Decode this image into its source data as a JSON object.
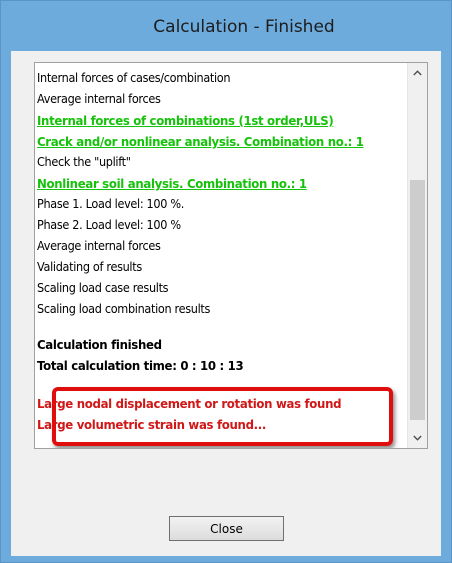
{
  "window": {
    "title": "Calculation - Finished"
  },
  "log": {
    "lines": [
      "Internal forces of cases/combination",
      "Average internal forces",
      "Internal forces of combinations (1st order,ULS)",
      "Crack and/or nonlinear analysis. Combination no.: 1",
      "Check the \"uplift\"",
      "Nonlinear soil analysis.  Combination no.: 1",
      "Phase 1. Load level: 100 %.",
      "Phase 2. Load level: 100 %",
      "Average internal forces",
      "Validating of results",
      "Scaling load case results",
      "Scaling load combination results"
    ],
    "summary": [
      "Calculation finished",
      "Total calculation time:  0 : 10 : 13"
    ],
    "warnings": [
      "Large nodal displacement or rotation was found",
      "Large volumetric strain was found..."
    ]
  },
  "scrollbar": {
    "up_icon": "chevron-up-icon",
    "down_icon": "chevron-down-icon"
  },
  "buttons": {
    "close_label": "Close"
  },
  "colors": {
    "link_green": "#16c20b",
    "warning_red": "#d01818",
    "highlight_border": "#e00d0d",
    "title_bar": "#6dabdd"
  }
}
